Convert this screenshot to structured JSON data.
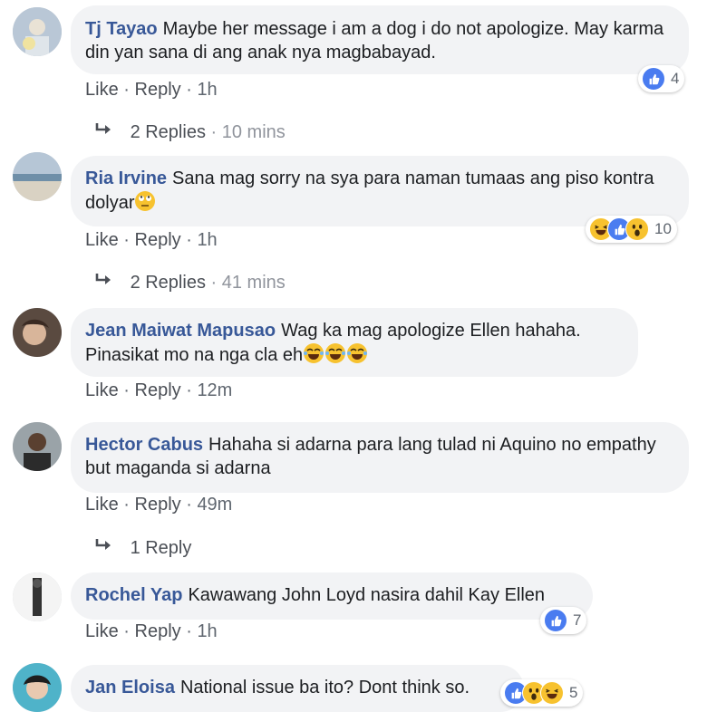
{
  "comments": [
    {
      "name": "Tj Tayao",
      "text": "Maybe her message i am a dog i do not apologize. May karma din yan sana di ang anak nya magbabayad.",
      "like": "Like",
      "reply": "Reply",
      "time": "1h",
      "reactions": {
        "icons": [
          "like-icon"
        ],
        "count": "4"
      },
      "replies": {
        "count": "2 Replies",
        "time": "10 mins"
      }
    },
    {
      "name": "Ria Irvine",
      "text": "Sana mag sorry na sya para naman tumaas ang piso kontra dolyar",
      "emoji": [
        "rolling-eyes-emoji"
      ],
      "like": "Like",
      "reply": "Reply",
      "time": "1h",
      "reactions": {
        "icons": [
          "haha-icon",
          "like-icon",
          "wow-icon"
        ],
        "count": "10"
      },
      "replies": {
        "count": "2 Replies",
        "time": "41 mins"
      }
    },
    {
      "name": "Jean Maiwat Mapusao",
      "text": "Wag ka mag apologize Ellen hahaha. Pinasikat mo na nga cla eh",
      "emoji": [
        "tears-of-joy-emoji",
        "tears-of-joy-emoji",
        "tears-of-joy-emoji"
      ],
      "like": "Like",
      "reply": "Reply",
      "time": "12m"
    },
    {
      "name": "Hector Cabus",
      "text": "Hahaha si adarna para lang tulad ni Aquino no empathy but maganda si adarna",
      "like": "Like",
      "reply": "Reply",
      "time": "49m",
      "replies": {
        "count": "1 Reply",
        "time": ""
      }
    },
    {
      "name": "Rochel Yap",
      "text": "Kawawang John Loyd nasira dahil Kay Ellen",
      "like": "Like",
      "reply": "Reply",
      "time": "1h",
      "reactions": {
        "icons": [
          "like-icon"
        ],
        "count": "7"
      }
    },
    {
      "name": "Jan Eloisa",
      "text": "National issue ba ito? Dont think so.",
      "reactions": {
        "icons": [
          "like-icon",
          "wow-icon",
          "haha-icon"
        ],
        "count": "5"
      }
    }
  ],
  "separator": "·",
  "colors": {
    "name": "#385898",
    "bubble": "#f2f3f5",
    "like": "#4a7cf0",
    "emoji": "#f7c22f"
  }
}
